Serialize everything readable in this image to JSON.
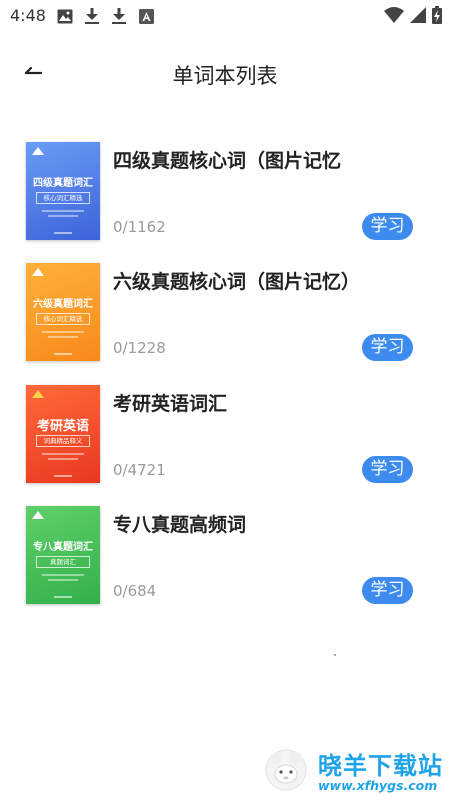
{
  "status_bar": {
    "time": "4:48",
    "left_icons": [
      "image-icon",
      "download-icon",
      "download-icon",
      "font-a-icon"
    ],
    "right_icons": [
      "wifi-icon",
      "signal-icon",
      "battery-icon"
    ]
  },
  "header": {
    "title": "单词本列表",
    "back_icon": "back-arrow-icon"
  },
  "books": [
    {
      "title": "四级真题核心词（图片记忆",
      "progress": "0/1162",
      "button_label": "学习",
      "cover": {
        "title": "四级真题词汇",
        "subtitle": "核心词汇精选",
        "color_top": "#6a9cf5",
        "color_bottom": "#3d63d9"
      }
    },
    {
      "title": "六级真题核心词（图片记忆）",
      "progress": "0/1228",
      "button_label": "学习",
      "cover": {
        "title": "六级真题词汇",
        "subtitle": "核心词汇精选",
        "color_top": "#ffb13a",
        "color_bottom": "#f7891a"
      }
    },
    {
      "title": "考研英语词汇",
      "progress": "0/4721",
      "button_label": "学习",
      "cover": {
        "title": "考研英语",
        "subtitle": "词典精品释义",
        "color_top": "#ff6a3a",
        "color_bottom": "#e9381f"
      }
    },
    {
      "title": "专八真题高频词",
      "progress": "0/684",
      "button_label": "学习",
      "cover": {
        "title": "专八真题词汇",
        "subtitle": "真题词汇",
        "color_top": "#5fd06a",
        "color_bottom": "#33b04a"
      }
    }
  ],
  "watermark": {
    "name": "晓羊下载站",
    "url": "www.xfhygs.com",
    "color": "#1fa3e8"
  },
  "colors": {
    "accent": "#3d8bef",
    "title_text": "#222222",
    "muted_text": "#9a9a9a"
  }
}
